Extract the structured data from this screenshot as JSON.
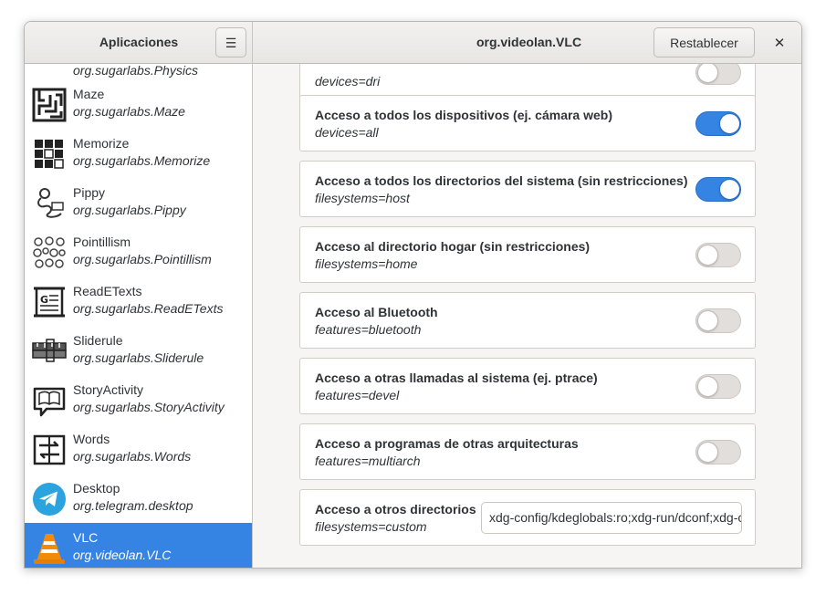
{
  "headerbar": {
    "sidebar_title": "Aplicaciones",
    "menu_icon": "hamburger-menu-icon",
    "window_title": "org.videolan.VLC",
    "reset_label": "Restablecer",
    "close_icon": "close-icon"
  },
  "sidebar": {
    "partial_item_id": "org.sugarlabs.Physics",
    "items": [
      {
        "name": "Maze",
        "id": "org.sugarlabs.Maze",
        "icon": "maze-icon"
      },
      {
        "name": "Memorize",
        "id": "org.sugarlabs.Memorize",
        "icon": "memorize-grid-icon"
      },
      {
        "name": "Pippy",
        "id": "org.sugarlabs.Pippy",
        "icon": "pippy-snake-icon"
      },
      {
        "name": "Pointillism",
        "id": "org.sugarlabs.Pointillism",
        "icon": "pointillism-dots-icon"
      },
      {
        "name": "ReadETexts",
        "id": "org.sugarlabs.ReadETexts",
        "icon": "read-etexts-icon"
      },
      {
        "name": "Sliderule",
        "id": "org.sugarlabs.Sliderule",
        "icon": "sliderule-icon"
      },
      {
        "name": "StoryActivity",
        "id": "org.sugarlabs.StoryActivity",
        "icon": "story-book-icon"
      },
      {
        "name": "Words",
        "id": "org.sugarlabs.Words",
        "icon": "words-book-icon"
      },
      {
        "name": "Desktop",
        "id": "org.telegram.desktop",
        "icon": "telegram-icon"
      },
      {
        "name": "VLC",
        "id": "org.videolan.VLC",
        "icon": "vlc-cone-icon",
        "selected": true
      }
    ]
  },
  "permissions": {
    "partial_sub": "devices=dri",
    "items": [
      {
        "title": "Acceso a todos los dispositivos (ej. cámara web)",
        "key": "devices=all",
        "enabled": true
      },
      {
        "title": "Acceso a todos los directorios del sistema (sin restricciones)",
        "key": "filesystems=host",
        "enabled": true
      },
      {
        "title": "Acceso al directorio hogar (sin restricciones)",
        "key": "filesystems=home",
        "enabled": false
      },
      {
        "title": "Acceso al Bluetooth",
        "key": "features=bluetooth",
        "enabled": false
      },
      {
        "title": "Acceso a otras llamadas al sistema (ej. ptrace)",
        "key": "features=devel",
        "enabled": false
      },
      {
        "title": "Acceso a programas de otras arquitecturas",
        "key": "features=multiarch",
        "enabled": false
      }
    ],
    "custom": {
      "title": "Acceso a otros directorios",
      "key": "filesystems=custom",
      "value": "xdg-config/kdeglobals:ro;xdg-run/dconf;xdg-config/dconf"
    }
  },
  "colors": {
    "accent": "#3584e4",
    "window_bg": "#f6f5f4"
  }
}
